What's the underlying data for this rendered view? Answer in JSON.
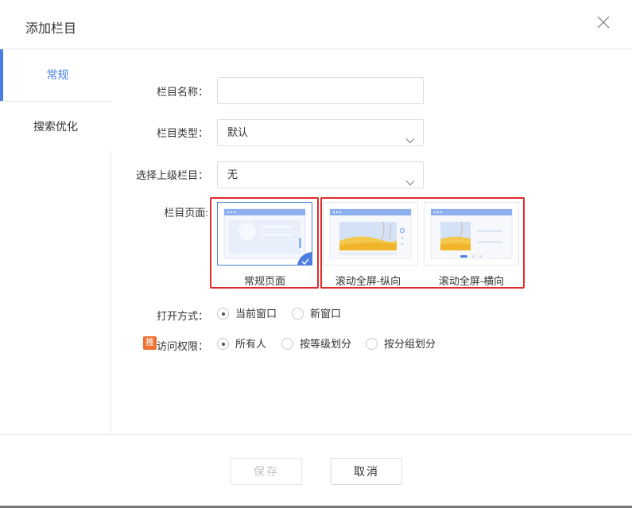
{
  "dialog": {
    "title": "添加栏目"
  },
  "tabs": [
    {
      "label": "常规"
    },
    {
      "label": "搜索优化"
    }
  ],
  "form": {
    "name_label": "栏目名称：",
    "name_value": "",
    "type_label": "栏目类型：",
    "type_value": "默认",
    "parent_label": "选择上级栏目：",
    "parent_value": "无",
    "page_label": "栏目页面:",
    "page_options": [
      {
        "label": "常规页面",
        "selected": true
      },
      {
        "label": "滚动全屏-纵向",
        "selected": false
      },
      {
        "label": "滚动全屏-横向",
        "selected": false
      }
    ],
    "open_label": "打开方式：",
    "open_options": [
      {
        "label": "当前窗口",
        "checked": true
      },
      {
        "label": "新窗口",
        "checked": false
      }
    ],
    "access_badge": "推",
    "access_label": "访问权限：",
    "access_options": [
      {
        "label": "所有人",
        "checked": true
      },
      {
        "label": "按等级划分",
        "checked": false
      },
      {
        "label": "按分组划分",
        "checked": false
      }
    ]
  },
  "footer": {
    "save_label": "保存",
    "cancel_label": "取消"
  },
  "colors": {
    "accent": "#4a7fe0",
    "highlight": "#e02a2a",
    "badge": "#f07030"
  },
  "icons": {
    "close": "close-icon",
    "dropdown": "chevron-down-icon",
    "check": "check-icon"
  }
}
